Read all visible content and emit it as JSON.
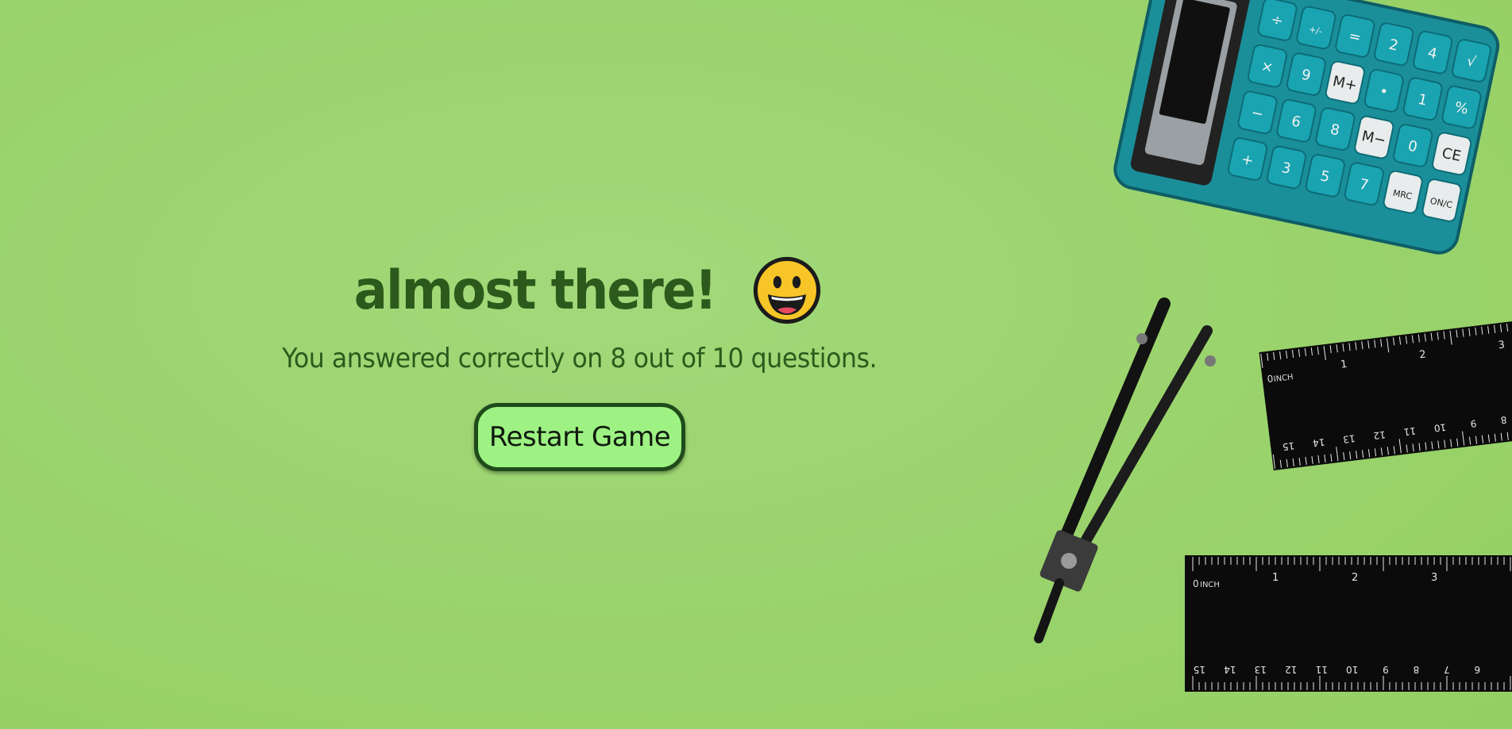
{
  "result": {
    "title": "almost there!",
    "emoji_icon": "grinning-face-icon",
    "message": "You answered correctly on 8 out of 10 questions.",
    "correct": 8,
    "total": 10
  },
  "actions": {
    "restart_label": "Restart Game"
  },
  "calculator": {
    "keys": [
      "÷",
      "×",
      "−",
      "+",
      "+/-",
      "9",
      "6",
      "3",
      "=",
      "M+",
      "8",
      "5",
      "2",
      "•",
      "M−",
      "7",
      "4",
      "1",
      "0",
      "MRC",
      "√",
      "%",
      "CE",
      "ON/C"
    ]
  },
  "ruler_top": {
    "unit": "INCH",
    "top_numbers": [
      "1",
      "2",
      "3"
    ],
    "bottom_numbers": [
      "15",
      "14",
      "13",
      "12",
      "11",
      "10",
      "9",
      "8"
    ]
  },
  "ruler_bottom": {
    "unit": "INCH",
    "top_numbers": [
      "1",
      "2",
      "3"
    ],
    "bottom_numbers": [
      "15",
      "14",
      "13",
      "12",
      "11",
      "10",
      "9",
      "8",
      "7",
      "6"
    ]
  },
  "colors": {
    "background": "#9bd46e",
    "text": "#2c5a1c",
    "button_fill": "#9df283",
    "button_border": "#1f4a1a",
    "calculator": "#1a8f9a"
  }
}
